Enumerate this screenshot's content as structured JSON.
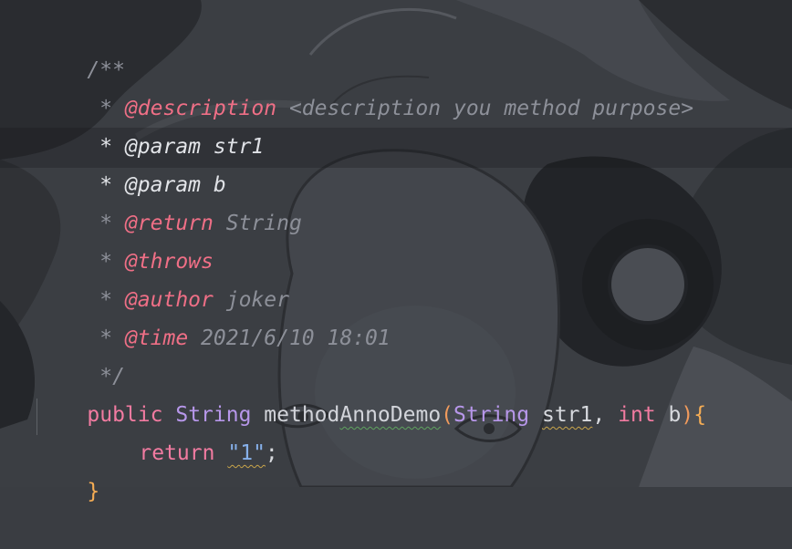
{
  "editor": {
    "language": "java",
    "colors": {
      "background": "#3a3d42",
      "comment": "#8d9099",
      "doc_tag": "#ef6f86",
      "keyword": "#f27ba1",
      "type": "#b797ea",
      "string": "#86b0ea",
      "paren": "#f09a5c",
      "brace": "#f6ad54"
    },
    "background_image": "anime-character-artwork",
    "javadoc": {
      "open": "/**",
      "lines": [
        {
          "prefix": " * ",
          "tag": "@description",
          "text": " <description you method purpose>"
        },
        {
          "prefix": " * ",
          "tag": "@param",
          "text": " str1"
        },
        {
          "prefix": " * ",
          "tag": "@param",
          "text": " b"
        },
        {
          "prefix": " * ",
          "tag": "@return",
          "text": " String"
        },
        {
          "prefix": " * ",
          "tag": "@throws",
          "text": ""
        },
        {
          "prefix": " * ",
          "tag": "@author",
          "text": " joker"
        },
        {
          "prefix": " * ",
          "tag": "@time",
          "text": " 2021/6/10 18:01"
        }
      ],
      "close": " */"
    },
    "signature": {
      "modifier": "public",
      "return_type": "String",
      "method_name_a": "method",
      "method_name_b": "AnnoDemo",
      "open_paren": "(",
      "param1_type": "String",
      "param1_name": "str1",
      "comma": ",",
      "param2_type": "int",
      "param2_name": "b",
      "close_paren": ")",
      "open_brace": "{"
    },
    "body": {
      "keyword": "return",
      "string": "\"1\"",
      "string_q1": "\"",
      "string_val": "1",
      "string_q2": "\"",
      "semicolon": ";"
    },
    "close_brace": "}"
  }
}
